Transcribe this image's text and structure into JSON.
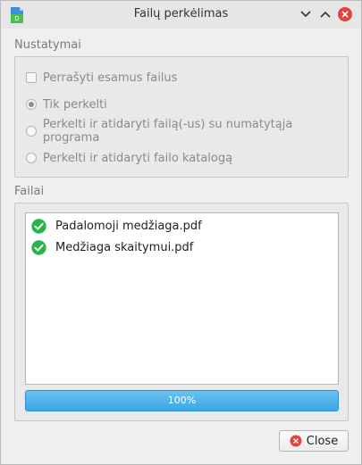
{
  "window": {
    "title": "Failų perkėlimas",
    "controls": [
      "chevron-down-icon",
      "chevron-up-icon",
      "close-icon"
    ]
  },
  "settings": {
    "title": "Nustatymai",
    "overwrite_label": "Perrašyti esamus failus",
    "overwrite_checked": false,
    "options": [
      {
        "label": "Tik perkelti",
        "selected": true
      },
      {
        "label": "Perkelti ir atidaryti failą(-us) su numatytąja programa",
        "selected": false
      },
      {
        "label": "Perkelti ir atidaryti failo katalogą",
        "selected": false
      }
    ],
    "enabled": false
  },
  "files": {
    "title": "Failai",
    "items": [
      {
        "name": "Padalomoji medžiaga.pdf",
        "status_icon": "check-circle-icon"
      },
      {
        "name": "Medžiaga skaitymui.pdf",
        "status_icon": "check-circle-icon"
      }
    ]
  },
  "progress": {
    "value": 100,
    "text": "100%"
  },
  "footer": {
    "close_label": "Close"
  },
  "colors": {
    "accent": "#3ba6e3",
    "success": "#2bb34b",
    "danger": "#e0443e"
  }
}
